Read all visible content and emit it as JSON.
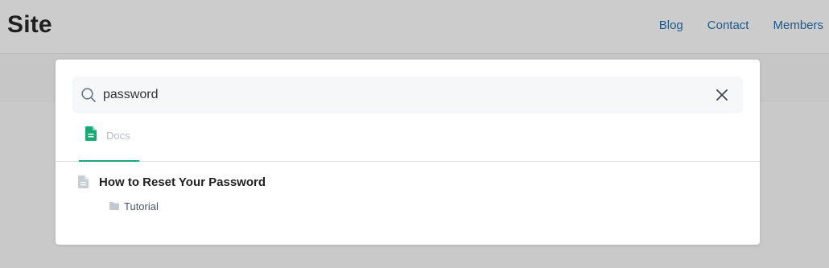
{
  "site": {
    "title": "Site",
    "nav": [
      "Blog",
      "Contact",
      "Members"
    ]
  },
  "search": {
    "value": "password",
    "clear_icon": "close-icon",
    "search_icon": "search-icon"
  },
  "tabs": [
    {
      "label": "Docs",
      "icon": "document-icon",
      "active": true
    }
  ],
  "results": [
    {
      "title": "How to Reset Your Password",
      "category": "Tutorial",
      "icon": "document-icon",
      "category_icon": "folder-icon"
    }
  ],
  "colors": {
    "accent": "#19a974",
    "link": "#1d5a8c",
    "overlay": "#cccccc"
  }
}
